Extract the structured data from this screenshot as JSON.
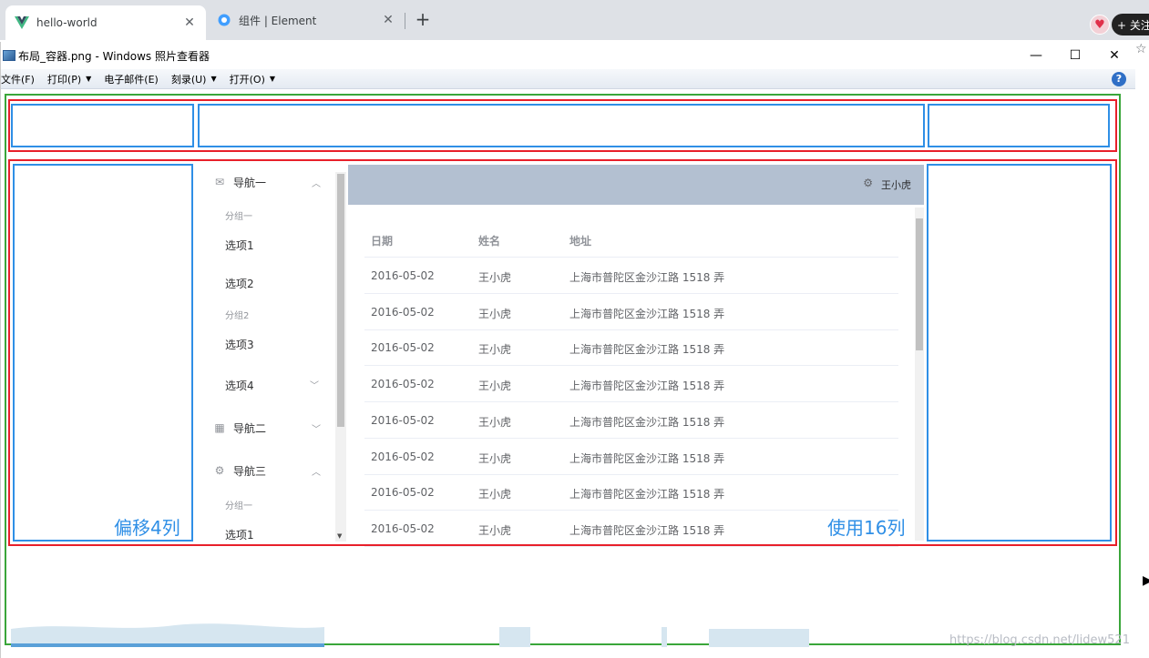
{
  "browser": {
    "tabs": [
      {
        "label": "hello-world",
        "close": "✕"
      },
      {
        "label": "组件 | Element",
        "close": "✕"
      }
    ],
    "new_tab": "+",
    "follow_label": "+ 关注"
  },
  "viewer": {
    "title": "布局_容器.png - Windows 照片查看器",
    "controls": {
      "minimize": "—",
      "maximize": "☐",
      "close": "✕"
    },
    "menu": [
      {
        "label": "文件(F)"
      },
      {
        "label": "打印(P)"
      },
      {
        "label": "电子邮件(E)"
      },
      {
        "label": "刻录(U)"
      },
      {
        "label": "打开(O)"
      }
    ],
    "help": "?"
  },
  "overlay": {
    "offset_label": "偏移4列",
    "span_label": "使用16列"
  },
  "nav": {
    "items": [
      {
        "label": "导航一",
        "icon": "mail-icon",
        "caret": "︿"
      },
      {
        "label": "导航二",
        "icon": "grid-icon",
        "caret": "﹀"
      },
      {
        "label": "导航三",
        "icon": "gear-icon",
        "caret": "︿"
      }
    ],
    "group1": "分组一",
    "option1": "选项1",
    "option2": "选项2",
    "group2": "分组2",
    "option3": "选项3",
    "option4": "选项4",
    "group3": "分组一",
    "option5": "选项1"
  },
  "header": {
    "user": "王小虎"
  },
  "table": {
    "columns": [
      "日期",
      "姓名",
      "地址"
    ],
    "rows": [
      [
        "2016-05-02",
        "王小虎",
        "上海市普陀区金沙江路 1518 弄"
      ],
      [
        "2016-05-02",
        "王小虎",
        "上海市普陀区金沙江路 1518 弄"
      ],
      [
        "2016-05-02",
        "王小虎",
        "上海市普陀区金沙江路 1518 弄"
      ],
      [
        "2016-05-02",
        "王小虎",
        "上海市普陀区金沙江路 1518 弄"
      ],
      [
        "2016-05-02",
        "王小虎",
        "上海市普陀区金沙江路 1518 弄"
      ],
      [
        "2016-05-02",
        "王小虎",
        "上海市普陀区金沙江路 1518 弄"
      ],
      [
        "2016-05-02",
        "王小虎",
        "上海市普陀区金沙江路 1518 弄"
      ],
      [
        "2016-05-02",
        "王小虎",
        "上海市普陀区金沙江路 1518 弄"
      ]
    ]
  },
  "watermark": "https://blog.csdn.net/lidew521"
}
